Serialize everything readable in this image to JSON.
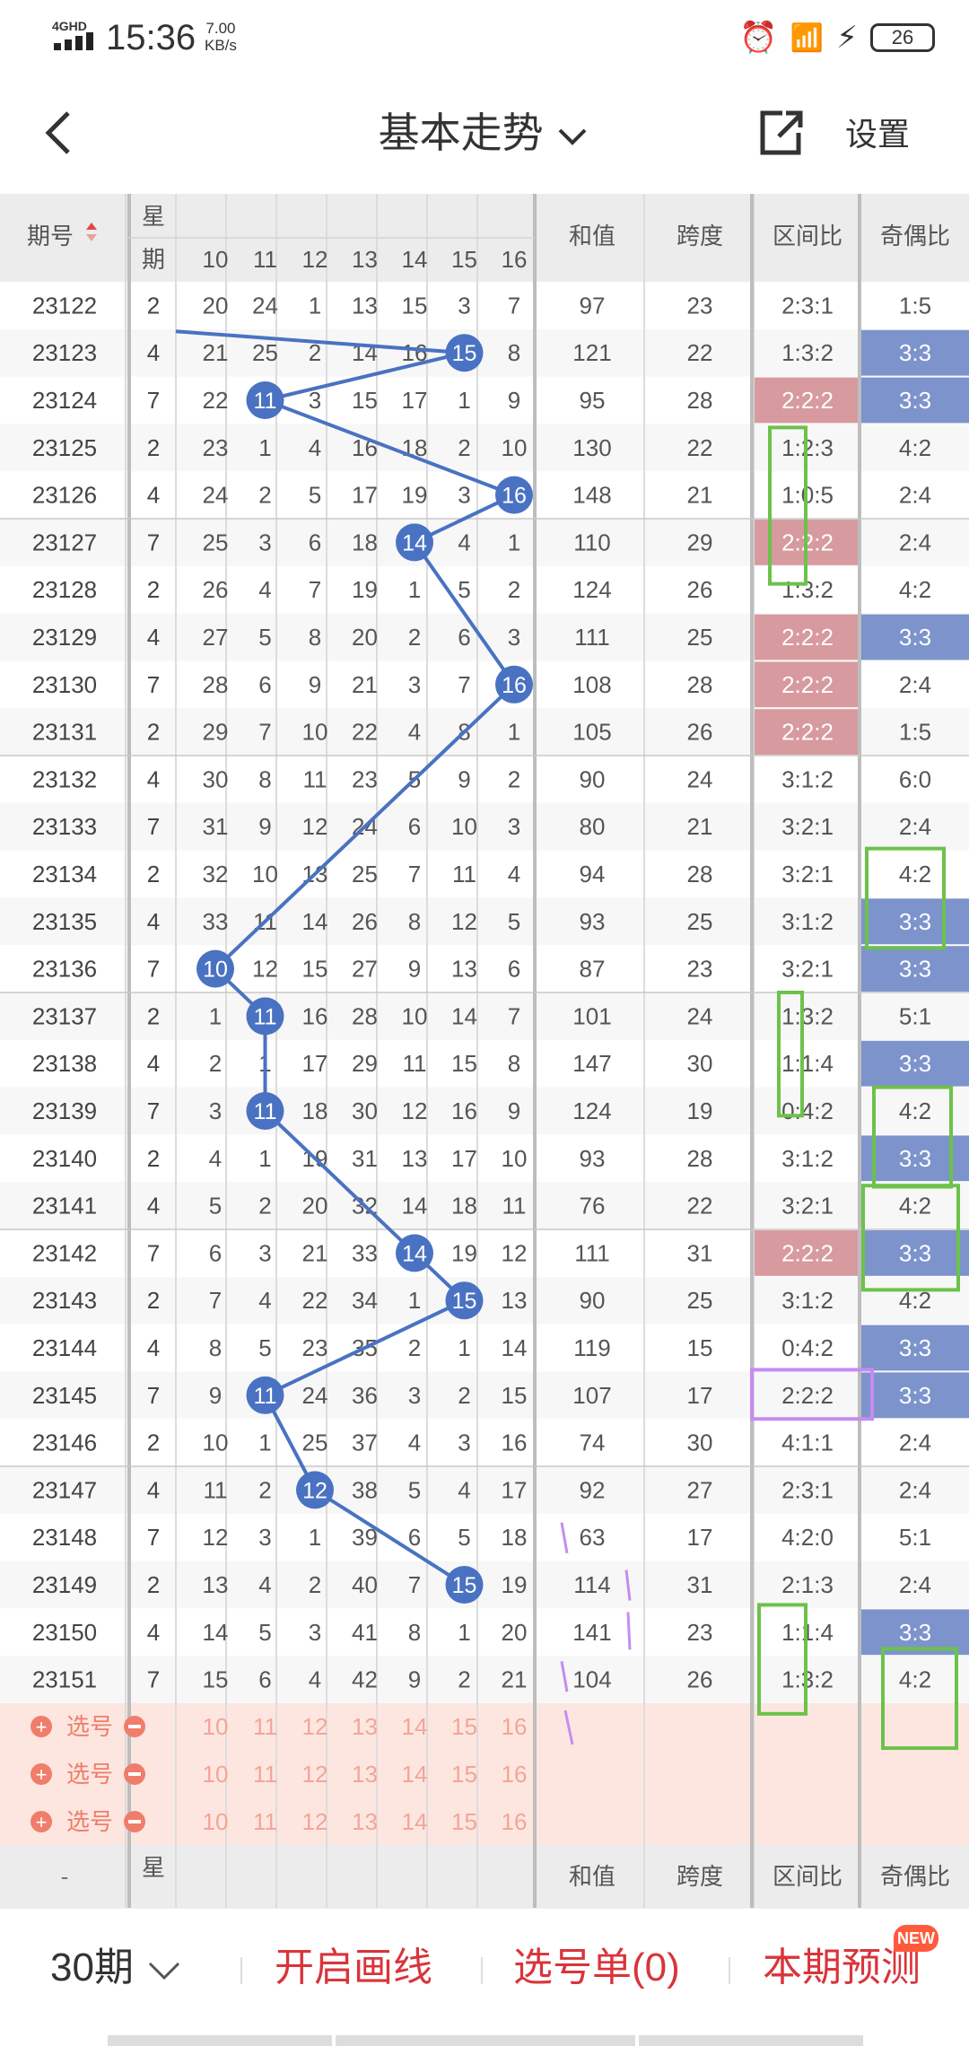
{
  "status_bar": {
    "network": "4GHD",
    "time": "15:36",
    "speed_value": "7.00",
    "speed_unit": "KB/s",
    "battery": "26"
  },
  "nav": {
    "title": "基本走势",
    "settings_label": "设置"
  },
  "header": {
    "period": "期号",
    "weekday": "星期",
    "numbers": [
      "10",
      "11",
      "12",
      "13",
      "14",
      "15",
      "16"
    ],
    "sum": "和值",
    "span": "跨度",
    "zone_ratio": "区间比",
    "odd_even": "奇偶比"
  },
  "rows": [
    {
      "period": "23122",
      "weekday": "2",
      "values": [
        "20",
        "24",
        "1",
        "13",
        "15",
        "3",
        "7"
      ],
      "sum": "97",
      "span": "23",
      "zone": "2:3:1",
      "oe": "1:5"
    },
    {
      "period": "23123",
      "weekday": "4",
      "values": [
        "21",
        "25",
        "2",
        "14",
        "16",
        "15",
        "8"
      ],
      "sum": "121",
      "span": "22",
      "zone": "1:3:2",
      "oe": "3:3",
      "hit_col": 5,
      "oe_hl": "blue"
    },
    {
      "period": "23124",
      "weekday": "7",
      "values": [
        "22",
        "11",
        "3",
        "15",
        "17",
        "1",
        "9"
      ],
      "sum": "95",
      "span": "28",
      "zone": "2:2:2",
      "oe": "3:3",
      "hit_col": 1,
      "zone_hl": "red",
      "oe_hl": "blue"
    },
    {
      "period": "23125",
      "weekday": "2",
      "values": [
        "23",
        "1",
        "4",
        "16",
        "18",
        "2",
        "10"
      ],
      "sum": "130",
      "span": "22",
      "zone": "1:2:3",
      "oe": "4:2"
    },
    {
      "period": "23126",
      "weekday": "4",
      "values": [
        "24",
        "2",
        "5",
        "17",
        "19",
        "3",
        "16"
      ],
      "sum": "148",
      "span": "21",
      "zone": "1:0:5",
      "oe": "2:4",
      "hit_col": 6
    },
    {
      "period": "23127",
      "weekday": "7",
      "values": [
        "25",
        "3",
        "6",
        "18",
        "14",
        "4",
        "1"
      ],
      "sum": "110",
      "span": "29",
      "zone": "2:2:2",
      "oe": "2:4",
      "hit_col": 4,
      "zone_hl": "red"
    },
    {
      "period": "23128",
      "weekday": "2",
      "values": [
        "26",
        "4",
        "7",
        "19",
        "1",
        "5",
        "2"
      ],
      "sum": "124",
      "span": "26",
      "zone": "1:3:2",
      "oe": "4:2"
    },
    {
      "period": "23129",
      "weekday": "4",
      "values": [
        "27",
        "5",
        "8",
        "20",
        "2",
        "6",
        "3"
      ],
      "sum": "111",
      "span": "25",
      "zone": "2:2:2",
      "oe": "3:3",
      "zone_hl": "red",
      "oe_hl": "blue"
    },
    {
      "period": "23130",
      "weekday": "7",
      "values": [
        "28",
        "6",
        "9",
        "21",
        "3",
        "7",
        "16"
      ],
      "sum": "108",
      "span": "28",
      "zone": "2:2:2",
      "oe": "2:4",
      "hit_col": 6,
      "zone_hl": "red"
    },
    {
      "period": "23131",
      "weekday": "2",
      "values": [
        "29",
        "7",
        "10",
        "22",
        "4",
        "8",
        "1"
      ],
      "sum": "105",
      "span": "26",
      "zone": "2:2:2",
      "oe": "1:5",
      "zone_hl": "red"
    },
    {
      "period": "23132",
      "weekday": "4",
      "values": [
        "30",
        "8",
        "11",
        "23",
        "5",
        "9",
        "2"
      ],
      "sum": "90",
      "span": "24",
      "zone": "3:1:2",
      "oe": "6:0"
    },
    {
      "period": "23133",
      "weekday": "7",
      "values": [
        "31",
        "9",
        "12",
        "24",
        "6",
        "10",
        "3"
      ],
      "sum": "80",
      "span": "21",
      "zone": "3:2:1",
      "oe": "2:4"
    },
    {
      "period": "23134",
      "weekday": "2",
      "values": [
        "32",
        "10",
        "13",
        "25",
        "7",
        "11",
        "4"
      ],
      "sum": "94",
      "span": "28",
      "zone": "3:2:1",
      "oe": "4:2"
    },
    {
      "period": "23135",
      "weekday": "4",
      "values": [
        "33",
        "11",
        "14",
        "26",
        "8",
        "12",
        "5"
      ],
      "sum": "93",
      "span": "25",
      "zone": "3:1:2",
      "oe": "3:3",
      "oe_hl": "blue"
    },
    {
      "period": "23136",
      "weekday": "7",
      "values": [
        "10",
        "12",
        "15",
        "27",
        "9",
        "13",
        "6"
      ],
      "sum": "87",
      "span": "23",
      "zone": "3:2:1",
      "oe": "3:3",
      "hit_col": 0,
      "oe_hl": "blue"
    },
    {
      "period": "23137",
      "weekday": "2",
      "values": [
        "1",
        "11",
        "16",
        "28",
        "10",
        "14",
        "7"
      ],
      "sum": "101",
      "span": "24",
      "zone": "1:3:2",
      "oe": "5:1",
      "hit_col": 1
    },
    {
      "period": "23138",
      "weekday": "4",
      "values": [
        "2",
        "1",
        "17",
        "29",
        "11",
        "15",
        "8"
      ],
      "sum": "147",
      "span": "30",
      "zone": "1:1:4",
      "oe": "3:3",
      "oe_hl": "blue"
    },
    {
      "period": "23139",
      "weekday": "7",
      "values": [
        "3",
        "11",
        "18",
        "30",
        "12",
        "16",
        "9"
      ],
      "sum": "124",
      "span": "19",
      "zone": "0:4:2",
      "oe": "4:2",
      "hit_col": 1
    },
    {
      "period": "23140",
      "weekday": "2",
      "values": [
        "4",
        "1",
        "19",
        "31",
        "13",
        "17",
        "10"
      ],
      "sum": "93",
      "span": "28",
      "zone": "3:1:2",
      "oe": "3:3",
      "oe_hl": "blue"
    },
    {
      "period": "23141",
      "weekday": "4",
      "values": [
        "5",
        "2",
        "20",
        "32",
        "14",
        "18",
        "11"
      ],
      "sum": "76",
      "span": "22",
      "zone": "3:2:1",
      "oe": "4:2"
    },
    {
      "period": "23142",
      "weekday": "7",
      "values": [
        "6",
        "3",
        "21",
        "33",
        "14",
        "19",
        "12"
      ],
      "sum": "111",
      "span": "31",
      "zone": "2:2:2",
      "oe": "3:3",
      "hit_col": 4,
      "zone_hl": "red",
      "oe_hl": "blue"
    },
    {
      "period": "23143",
      "weekday": "2",
      "values": [
        "7",
        "4",
        "22",
        "34",
        "1",
        "15",
        "13"
      ],
      "sum": "90",
      "span": "25",
      "zone": "3:1:2",
      "oe": "4:2",
      "hit_col": 5
    },
    {
      "period": "23144",
      "weekday": "4",
      "values": [
        "8",
        "5",
        "23",
        "35",
        "2",
        "1",
        "14"
      ],
      "sum": "119",
      "span": "15",
      "zone": "0:4:2",
      "oe": "3:3",
      "oe_hl": "blue"
    },
    {
      "period": "23145",
      "weekday": "7",
      "values": [
        "9",
        "11",
        "24",
        "36",
        "3",
        "2",
        "15"
      ],
      "sum": "107",
      "span": "17",
      "zone": "2:2:2",
      "oe": "3:3",
      "hit_col": 1,
      "oe_hl": "blue"
    },
    {
      "period": "23146",
      "weekday": "2",
      "values": [
        "10",
        "1",
        "25",
        "37",
        "4",
        "3",
        "16"
      ],
      "sum": "74",
      "span": "30",
      "zone": "4:1:1",
      "oe": "2:4"
    },
    {
      "period": "23147",
      "weekday": "4",
      "values": [
        "11",
        "2",
        "12",
        "38",
        "5",
        "4",
        "17"
      ],
      "sum": "92",
      "span": "27",
      "zone": "2:3:1",
      "oe": "2:4",
      "hit_col": 2
    },
    {
      "period": "23148",
      "weekday": "7",
      "values": [
        "12",
        "3",
        "1",
        "39",
        "6",
        "5",
        "18"
      ],
      "sum": "63",
      "span": "17",
      "zone": "4:2:0",
      "oe": "5:1"
    },
    {
      "period": "23149",
      "weekday": "2",
      "values": [
        "13",
        "4",
        "2",
        "40",
        "7",
        "15",
        "19"
      ],
      "sum": "114",
      "span": "31",
      "zone": "2:1:3",
      "oe": "2:4",
      "hit_col": 5
    },
    {
      "period": "23150",
      "weekday": "4",
      "values": [
        "14",
        "5",
        "3",
        "41",
        "8",
        "1",
        "20"
      ],
      "sum": "141",
      "span": "23",
      "zone": "1:1:4",
      "oe": "3:3",
      "oe_hl": "blue"
    },
    {
      "period": "23151",
      "weekday": "7",
      "values": [
        "15",
        "6",
        "4",
        "42",
        "9",
        "2",
        "21"
      ],
      "sum": "104",
      "span": "26",
      "zone": "1:3:2",
      "oe": "4:2"
    }
  ],
  "picker": {
    "label": "选号",
    "numbers": [
      "10",
      "11",
      "12",
      "13",
      "14",
      "15",
      "16"
    ]
  },
  "bottom": {
    "periods": "30期",
    "draw_lines": "开启画线",
    "ticket": "选号单(0)",
    "predict": "本期预测",
    "new_badge": "NEW"
  },
  "colors": {
    "hit_ball": "#4a72c2",
    "zone_highlight": "#d79a9f",
    "oe_highlight": "#7d93cc",
    "accent_red": "#d9343b",
    "picker_bg": "#fde6e0",
    "annotation_green": "#6cc24a",
    "annotation_purple": "#c58cf0"
  }
}
